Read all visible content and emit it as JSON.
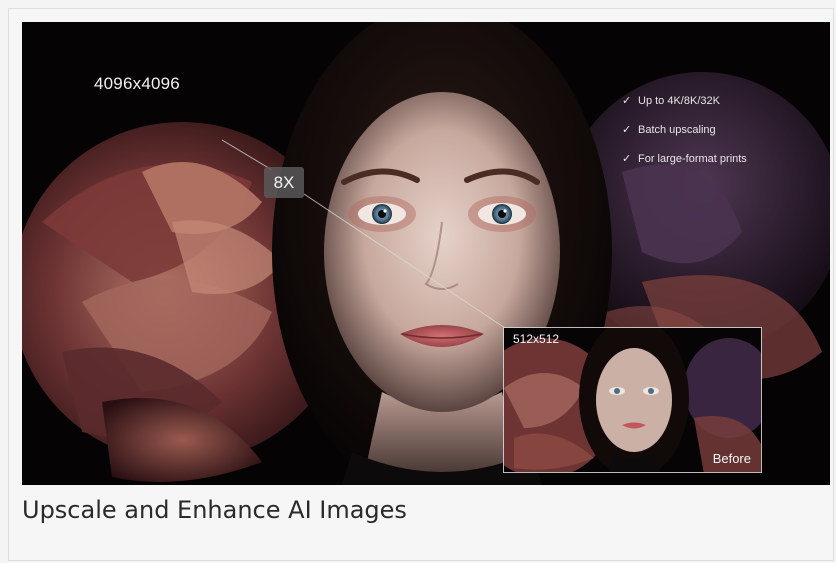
{
  "hero": {
    "large_resolution": "4096x4096",
    "zoom_factor": "8X",
    "features": [
      "Up to 4K/8K/32K",
      "Batch upscaling",
      "For large-format prints"
    ],
    "preview": {
      "resolution": "512x512",
      "label": "Before"
    },
    "check_icon": "check-icon"
  },
  "caption": {
    "title": "Upscale and Enhance AI Images"
  },
  "colors": {
    "background": "#050304",
    "petal_dark": "#5a2a2c",
    "petal_light": "#a5685e",
    "purple_petal": "#3a2540",
    "skin": "#d9c2b9",
    "lips": "#c2585d",
    "caption_text": "#2a2a2a"
  }
}
